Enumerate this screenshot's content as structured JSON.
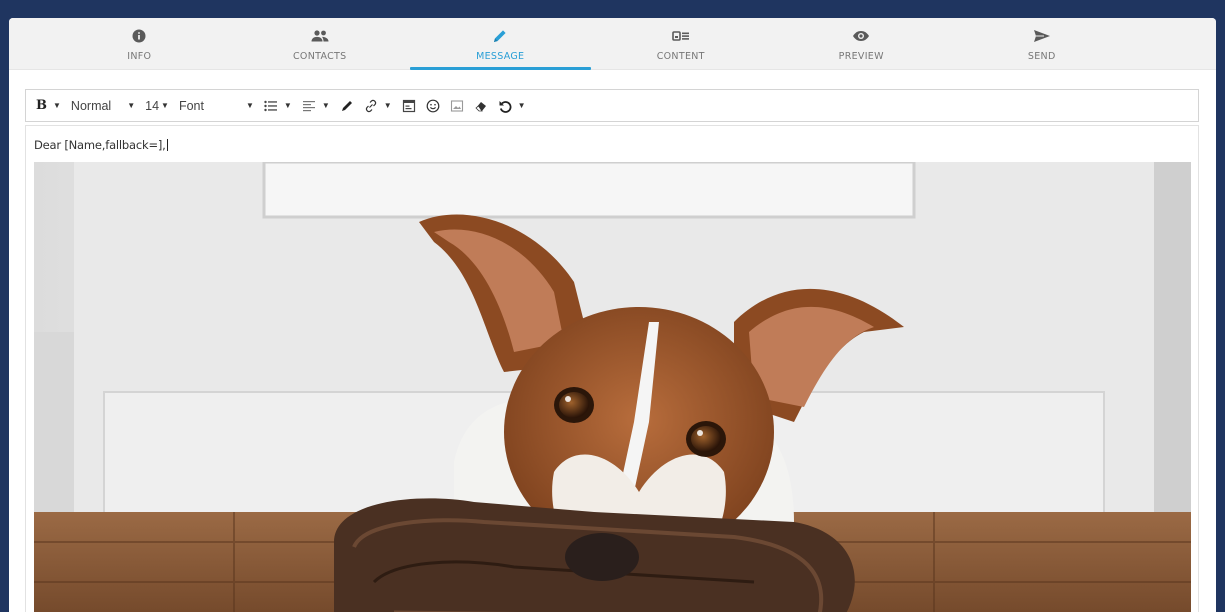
{
  "steps": [
    {
      "label": "INFO",
      "icon": "info-icon"
    },
    {
      "label": "CONTACTS",
      "icon": "contacts-icon"
    },
    {
      "label": "MESSAGE",
      "icon": "pencil-icon"
    },
    {
      "label": "CONTENT",
      "icon": "content-icon"
    },
    {
      "label": "PREVIEW",
      "icon": "eye-icon"
    },
    {
      "label": "SEND",
      "icon": "send-icon"
    }
  ],
  "active_step": "MESSAGE",
  "toolbar": {
    "bold_label": "B",
    "paragraph_style": "Normal",
    "font_size": "14",
    "font_family": "Font"
  },
  "editor": {
    "salutation": "Dear [Name,fallback=],",
    "image_subject": "dog-with-leash-photo"
  },
  "colors": {
    "background": "#1f3560",
    "accent": "#2a9fd6",
    "tabs_bg": "#f2f2f2"
  }
}
